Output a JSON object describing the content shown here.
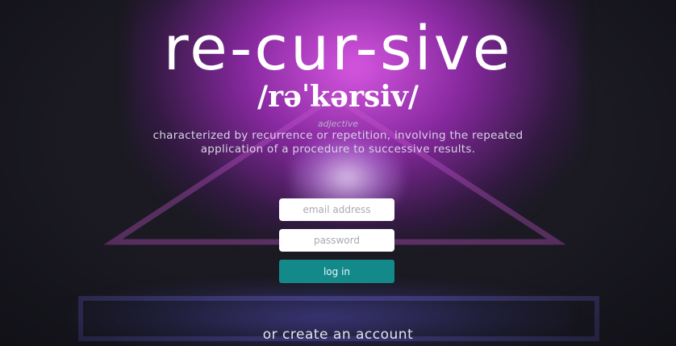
{
  "header": {
    "title": "re-cur-sive",
    "phonetic": "/rəˈkərsiv/",
    "part_of_speech": "adjective",
    "definition": "characterized by recurrence or repetition, involving the repeated application of a procedure to successive results."
  },
  "login_form": {
    "email_placeholder": "email address",
    "password_placeholder": "password",
    "login_label": "log in"
  },
  "footer": {
    "create_account_label": "or create an account"
  },
  "colors": {
    "background": "#1b1a22",
    "glow": "#d94fe6",
    "login_button": "#14898a",
    "text": "#ffffff"
  }
}
